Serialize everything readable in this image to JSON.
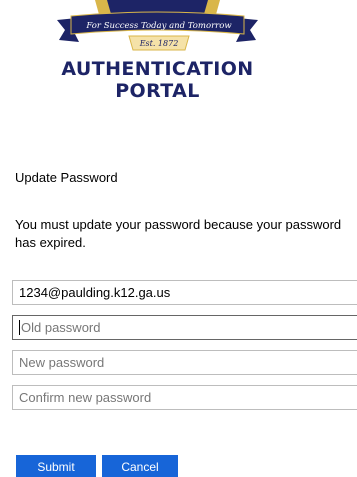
{
  "logo": {
    "ribbon_text": "For Success Today and Tomorrow",
    "est_text": "Est. 1872",
    "title_line1": "AUTHENTICATION",
    "title_line2": "PORTAL"
  },
  "form": {
    "heading": "Update Password",
    "message_line1": "You must update your password because your password",
    "message_line2": "has expired.",
    "username_value": "1234@paulding.k12.ga.us",
    "old_password_placeholder": "Old password",
    "new_password_placeholder": "New password",
    "confirm_password_placeholder": "Confirm new password"
  },
  "buttons": {
    "submit_label": "Submit",
    "cancel_label": "Cancel"
  },
  "colors": {
    "brand_navy": "#1d2466",
    "brand_gold": "#d9b64a",
    "button_blue": "#1765d8"
  }
}
